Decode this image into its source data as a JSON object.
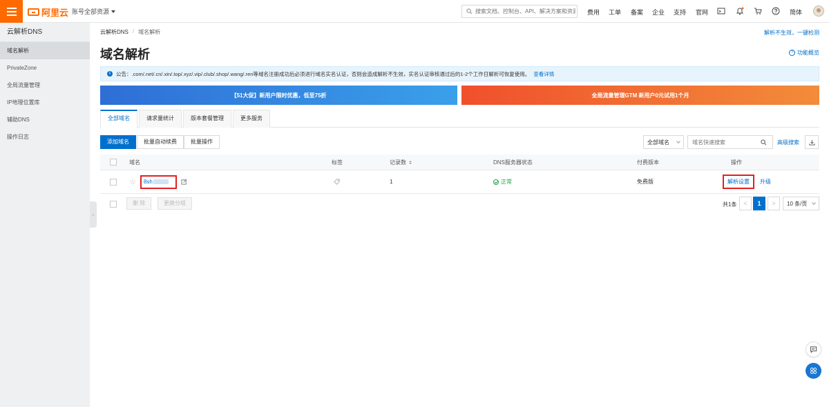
{
  "topbar": {
    "brand": "阿里云",
    "account_select": "账号全部资源",
    "search_placeholder": "搜索文档、控制台、API、解决方案和资源",
    "nav": [
      "费用",
      "工单",
      "备案",
      "企业",
      "支持",
      "官网"
    ],
    "lang": "简体",
    "accent_color": "#ff6a00",
    "icons": [
      "terminal-icon",
      "bell-icon",
      "cart-icon",
      "help-icon"
    ]
  },
  "sidebar": {
    "title": "云解析DNS",
    "items": [
      {
        "label": "域名解析",
        "active": true
      },
      {
        "label": "PrivateZone",
        "active": false
      },
      {
        "label": "全局流量管理",
        "active": false
      },
      {
        "label": "IP地理位置库",
        "active": false
      },
      {
        "label": "辅助DNS",
        "active": false
      },
      {
        "label": "操作日志",
        "active": false
      }
    ]
  },
  "breadcrumb": [
    "云解析DNS",
    "域名解析"
  ],
  "top_right_link": "解析不生效，一键检测",
  "page_title": "域名解析",
  "help_link": "功能概览",
  "notice": {
    "text": "公告：.com/.net/.cn/.xin/.top/.xyz/.vip/.club/.shop/.wang/.ren等域名注册成功后必须进行域名实名认证，否则会造成解析不生效，实名认证审核通过后的1-2个工作日解析可恢复使用。",
    "link": "查看详情"
  },
  "banners": {
    "left": "【51大促】新用户限时优惠，低至75折",
    "right": "全局流量管理GTM 新用户0元试用1个月"
  },
  "tabs": [
    "全部域名",
    "请求量统计",
    "版本套餐管理",
    "更多服务"
  ],
  "toolbar": {
    "add_domain": "添加域名",
    "batch_renew": "批量自动续费",
    "batch_ops": "批量操作",
    "filter_select": "全部域名",
    "filter_placeholder": "域名快速搜索",
    "advanced_search": "高级搜索"
  },
  "table": {
    "columns": [
      "域名",
      "标签",
      "记录数",
      "DNS服务器状态",
      "付费版本",
      "操作"
    ],
    "rows": [
      {
        "domain": "8sh",
        "records": "1",
        "dns_status": "正常",
        "plan": "免费版",
        "action_primary": "解析设置",
        "action_secondary": "升级"
      }
    ]
  },
  "footer": {
    "delete": "删 除",
    "change_group": "更换分组",
    "total": "共1条",
    "prev": "<",
    "current_page": "1",
    "next": ">",
    "page_size": "10 条/页"
  },
  "colors": {
    "primary": "#0070cc",
    "highlight_box": "#e02020",
    "status_ok": "#22a046"
  }
}
